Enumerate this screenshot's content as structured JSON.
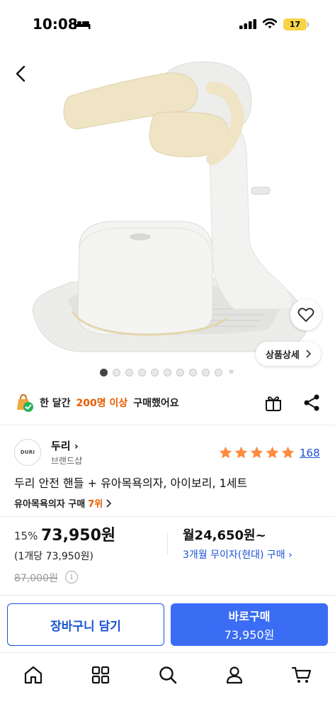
{
  "status_bar": {
    "time": "10:08",
    "battery": "17"
  },
  "hero": {
    "detail_label": "상품상세",
    "image_count": 11,
    "active_index": 0
  },
  "banner": {
    "part1": "한 달간",
    "highlight": "200명 이상",
    "part2": "구매했어요"
  },
  "brand": {
    "logo_text": "DURI",
    "name": "두리",
    "type": "브랜드샵"
  },
  "rating": {
    "stars": 5,
    "review_count": "168"
  },
  "product": {
    "title": "두리 안전 핸들 + 유아목욕의자, 아이보리, 1세트",
    "rank_label": "유아목욕의자 구매",
    "rank": "7위"
  },
  "price": {
    "discount": "15%",
    "sale_price": "73,950원",
    "unit_price": "(1개당 73,950원)",
    "original_price": "87,000원",
    "monthly_price": "월24,650원~",
    "installment": "3개월 무이자(현대) 구매"
  },
  "actions": {
    "cart_label": "장바구니 담기",
    "buy_label": "바로구매",
    "buy_price": "73,950원"
  },
  "colors": {
    "accent_blue": "#3a6cf4",
    "link_blue": "#1a52d6",
    "orange": "#e85d00",
    "star": "#ff8a3d",
    "product_cream": "#efe4c4"
  }
}
